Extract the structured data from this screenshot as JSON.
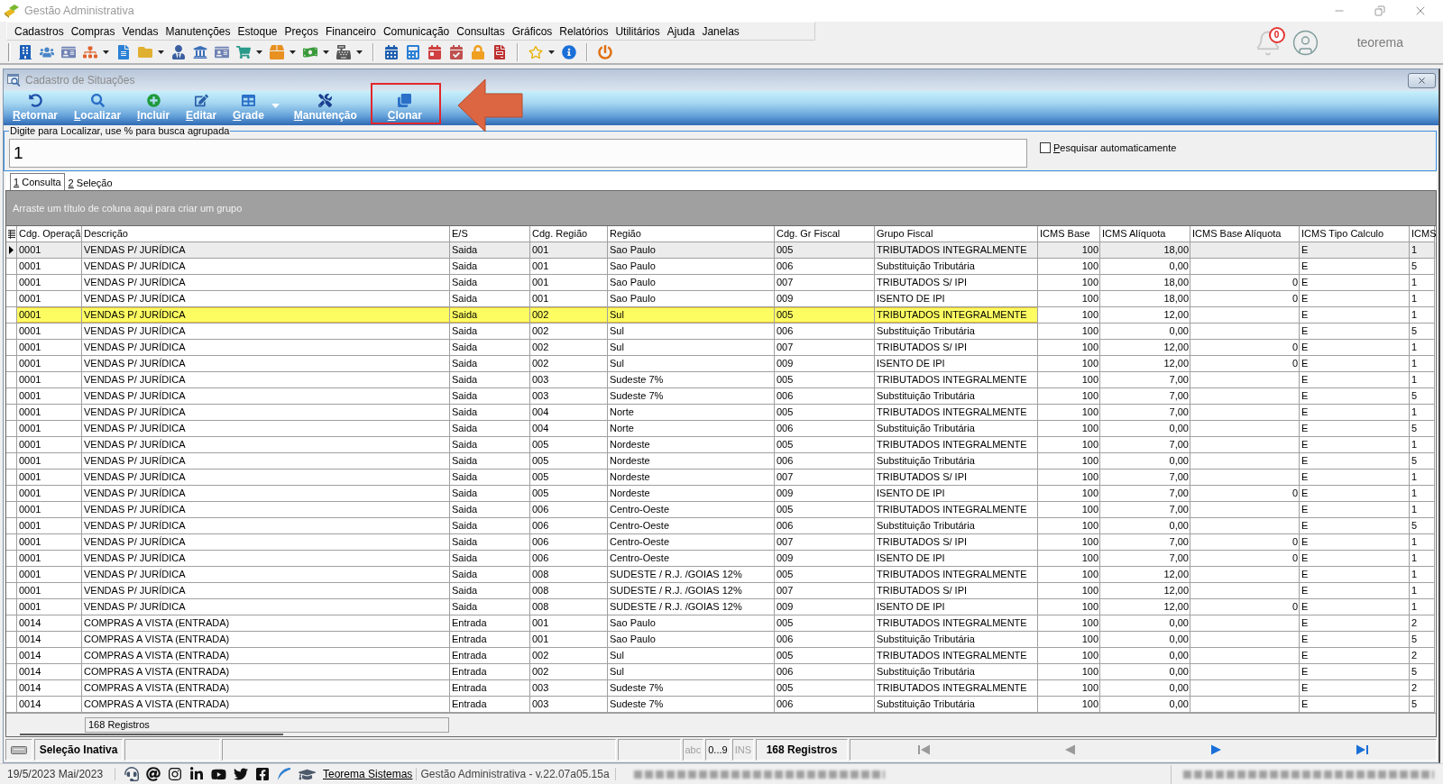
{
  "app_window": {
    "title": "Gestão Administrativa"
  },
  "menu": [
    "Cadastros",
    "Compras",
    "Vendas",
    "Manutenções",
    "Estoque",
    "Preços",
    "Financeiro",
    "Comunicação",
    "Consultas",
    "Gráficos",
    "Relatórios",
    "Utilitários",
    "Ajuda",
    "Janelas"
  ],
  "user_area": {
    "notification_count": "0",
    "user_name": "teorema"
  },
  "child_window": {
    "title": "Cadastro de Situações"
  },
  "toolbar": [
    {
      "label": "Retornar",
      "dropdown": false,
      "highlighted": false
    },
    {
      "label": "Localizar",
      "dropdown": false,
      "highlighted": false
    },
    {
      "label": "Incluir",
      "dropdown": false,
      "highlighted": false
    },
    {
      "label": "Editar",
      "dropdown": false,
      "highlighted": false
    },
    {
      "label": "Grade",
      "dropdown": true,
      "highlighted": false
    },
    {
      "label": "Manutenção",
      "dropdown": false,
      "highlighted": false
    },
    {
      "label": "Clonar",
      "dropdown": false,
      "highlighted": true
    }
  ],
  "search": {
    "legend": "Digite para Localizar, use % para busca agrupada",
    "value": "1",
    "auto_search": {
      "label": "Pesquisar automaticamente",
      "checked": false
    }
  },
  "tabs": [
    {
      "label": "1 Consulta",
      "selected": true
    },
    {
      "label": "2 Seleção",
      "selected": false
    }
  ],
  "group_panel": {
    "hint": "Arraste um título de coluna aqui para criar um grupo"
  },
  "table": {
    "columns": [
      "Cdg. Operaçã",
      "Descrição",
      "E/S",
      "Cdg. Região",
      "Região",
      "Cdg. Gr Fiscal",
      "Grupo Fiscal",
      "ICMS Base",
      "ICMS Alíquota",
      "ICMS Base Alíquota",
      "ICMS Tipo Calculo",
      "ICMS"
    ],
    "rows": [
      {
        "cdg_operacao": "0001",
        "descricao": "VENDAS P/ JURÍDICA",
        "e_s": "Saida",
        "cdg_regiao": "001",
        "regiao": "Sao Paulo",
        "cdg_gr_fiscal": "005",
        "grupo_fiscal": "TRIBUTADOS INTEGRALMENTE",
        "icms_base": "100",
        "icms_aliquota": "18,00",
        "icms_tipo_calculo": "E",
        "icms": "1",
        "selected": true,
        "highlighted": false
      },
      {
        "cdg_operacao": "0001",
        "descricao": "VENDAS P/ JURÍDICA",
        "e_s": "Saida",
        "cdg_regiao": "001",
        "regiao": "Sao Paulo",
        "cdg_gr_fiscal": "006",
        "grupo_fiscal": "Substituição Tributária",
        "icms_base": "100",
        "icms_aliquota": "0,00",
        "icms_tipo_calculo": "E",
        "icms": "5",
        "selected": false,
        "highlighted": false
      },
      {
        "cdg_operacao": "0001",
        "descricao": "VENDAS P/ JURÍDICA",
        "e_s": "Saida",
        "cdg_regiao": "001",
        "regiao": "Sao Paulo",
        "cdg_gr_fiscal": "007",
        "grupo_fiscal": "TRIBUTADOS S/ IPI",
        "icms_base": "100",
        "icms_aliquota": "18,00",
        "icms_base_aliquota": "0",
        "icms_tipo_calculo": "E",
        "icms": "1",
        "selected": false,
        "highlighted": false
      },
      {
        "cdg_operacao": "0001",
        "descricao": "VENDAS P/ JURÍDICA",
        "e_s": "Saida",
        "cdg_regiao": "001",
        "regiao": "Sao Paulo",
        "cdg_gr_fiscal": "009",
        "grupo_fiscal": "ISENTO DE IPI",
        "icms_base": "100",
        "icms_aliquota": "18,00",
        "icms_base_aliquota": "0",
        "icms_tipo_calculo": "E",
        "icms": "1",
        "selected": false,
        "highlighted": false
      },
      {
        "cdg_operacao": "0001",
        "descricao": "VENDAS P/ JURÍDICA",
        "e_s": "Saida",
        "cdg_regiao": "002",
        "regiao": "Sul",
        "cdg_gr_fiscal": "005",
        "grupo_fiscal": "TRIBUTADOS INTEGRALMENTE",
        "icms_base": "100",
        "icms_aliquota": "12,00",
        "icms_tipo_calculo": "E",
        "icms": "1",
        "selected": false,
        "highlighted": true
      },
      {
        "cdg_operacao": "0001",
        "descricao": "VENDAS P/ JURÍDICA",
        "e_s": "Saida",
        "cdg_regiao": "002",
        "regiao": "Sul",
        "cdg_gr_fiscal": "006",
        "grupo_fiscal": "Substituição Tributária",
        "icms_base": "100",
        "icms_aliquota": "0,00",
        "icms_tipo_calculo": "E",
        "icms": "5",
        "selected": false,
        "highlighted": false
      },
      {
        "cdg_operacao": "0001",
        "descricao": "VENDAS P/ JURÍDICA",
        "e_s": "Saida",
        "cdg_regiao": "002",
        "regiao": "Sul",
        "cdg_gr_fiscal": "007",
        "grupo_fiscal": "TRIBUTADOS S/ IPI",
        "icms_base": "100",
        "icms_aliquota": "12,00",
        "icms_base_aliquota": "0",
        "icms_tipo_calculo": "E",
        "icms": "1",
        "selected": false,
        "highlighted": false
      },
      {
        "cdg_operacao": "0001",
        "descricao": "VENDAS P/ JURÍDICA",
        "e_s": "Saida",
        "cdg_regiao": "002",
        "regiao": "Sul",
        "cdg_gr_fiscal": "009",
        "grupo_fiscal": "ISENTO DE IPI",
        "icms_base": "100",
        "icms_aliquota": "12,00",
        "icms_base_aliquota": "0",
        "icms_tipo_calculo": "E",
        "icms": "1",
        "selected": false,
        "highlighted": false
      },
      {
        "cdg_operacao": "0001",
        "descricao": "VENDAS P/ JURÍDICA",
        "e_s": "Saida",
        "cdg_regiao": "003",
        "regiao": "Sudeste 7%",
        "cdg_gr_fiscal": "005",
        "grupo_fiscal": "TRIBUTADOS INTEGRALMENTE",
        "icms_base": "100",
        "icms_aliquota": "7,00",
        "icms_tipo_calculo": "E",
        "icms": "1",
        "selected": false,
        "highlighted": false
      },
      {
        "cdg_operacao": "0001",
        "descricao": "VENDAS P/ JURÍDICA",
        "e_s": "Saida",
        "cdg_regiao": "003",
        "regiao": "Sudeste 7%",
        "cdg_gr_fiscal": "006",
        "grupo_fiscal": "Substituição Tributária",
        "icms_base": "100",
        "icms_aliquota": "7,00",
        "icms_tipo_calculo": "E",
        "icms": "5",
        "selected": false,
        "highlighted": false
      },
      {
        "cdg_operacao": "0001",
        "descricao": "VENDAS P/ JURÍDICA",
        "e_s": "Saida",
        "cdg_regiao": "004",
        "regiao": "Norte",
        "cdg_gr_fiscal": "005",
        "grupo_fiscal": "TRIBUTADOS INTEGRALMENTE",
        "icms_base": "100",
        "icms_aliquota": "7,00",
        "icms_tipo_calculo": "E",
        "icms": "1",
        "selected": false,
        "highlighted": false
      },
      {
        "cdg_operacao": "0001",
        "descricao": "VENDAS P/ JURÍDICA",
        "e_s": "Saida",
        "cdg_regiao": "004",
        "regiao": "Norte",
        "cdg_gr_fiscal": "006",
        "grupo_fiscal": "Substituição Tributária",
        "icms_base": "100",
        "icms_aliquota": "0,00",
        "icms_tipo_calculo": "E",
        "icms": "5",
        "selected": false,
        "highlighted": false
      },
      {
        "cdg_operacao": "0001",
        "descricao": "VENDAS P/ JURÍDICA",
        "e_s": "Saida",
        "cdg_regiao": "005",
        "regiao": "Nordeste",
        "cdg_gr_fiscal": "005",
        "grupo_fiscal": "TRIBUTADOS INTEGRALMENTE",
        "icms_base": "100",
        "icms_aliquota": "7,00",
        "icms_tipo_calculo": "E",
        "icms": "1",
        "selected": false,
        "highlighted": false
      },
      {
        "cdg_operacao": "0001",
        "descricao": "VENDAS P/ JURÍDICA",
        "e_s": "Saida",
        "cdg_regiao": "005",
        "regiao": "Nordeste",
        "cdg_gr_fiscal": "006",
        "grupo_fiscal": "Substituição Tributária",
        "icms_base": "100",
        "icms_aliquota": "0,00",
        "icms_tipo_calculo": "E",
        "icms": "5",
        "selected": false,
        "highlighted": false
      },
      {
        "cdg_operacao": "0001",
        "descricao": "VENDAS P/ JURÍDICA",
        "e_s": "Saida",
        "cdg_regiao": "005",
        "regiao": "Nordeste",
        "cdg_gr_fiscal": "007",
        "grupo_fiscal": "TRIBUTADOS S/ IPI",
        "icms_base": "100",
        "icms_aliquota": "7,00",
        "icms_tipo_calculo": "E",
        "icms": "1",
        "selected": false,
        "highlighted": false
      },
      {
        "cdg_operacao": "0001",
        "descricao": "VENDAS P/ JURÍDICA",
        "e_s": "Saida",
        "cdg_regiao": "005",
        "regiao": "Nordeste",
        "cdg_gr_fiscal": "009",
        "grupo_fiscal": "ISENTO DE IPI",
        "icms_base": "100",
        "icms_aliquota": "7,00",
        "icms_base_aliquota": "0",
        "icms_tipo_calculo": "E",
        "icms": "1",
        "selected": false,
        "highlighted": false
      },
      {
        "cdg_operacao": "0001",
        "descricao": "VENDAS P/ JURÍDICA",
        "e_s": "Saida",
        "cdg_regiao": "006",
        "regiao": "Centro-Oeste",
        "cdg_gr_fiscal": "005",
        "grupo_fiscal": "TRIBUTADOS INTEGRALMENTE",
        "icms_base": "100",
        "icms_aliquota": "7,00",
        "icms_tipo_calculo": "E",
        "icms": "1",
        "selected": false,
        "highlighted": false
      },
      {
        "cdg_operacao": "0001",
        "descricao": "VENDAS P/ JURÍDICA",
        "e_s": "Saida",
        "cdg_regiao": "006",
        "regiao": "Centro-Oeste",
        "cdg_gr_fiscal": "006",
        "grupo_fiscal": "Substituição Tributária",
        "icms_base": "100",
        "icms_aliquota": "0,00",
        "icms_tipo_calculo": "E",
        "icms": "5",
        "selected": false,
        "highlighted": false
      },
      {
        "cdg_operacao": "0001",
        "descricao": "VENDAS P/ JURÍDICA",
        "e_s": "Saida",
        "cdg_regiao": "006",
        "regiao": "Centro-Oeste",
        "cdg_gr_fiscal": "007",
        "grupo_fiscal": "TRIBUTADOS S/ IPI",
        "icms_base": "100",
        "icms_aliquota": "7,00",
        "icms_base_aliquota": "0",
        "icms_tipo_calculo": "E",
        "icms": "1",
        "selected": false,
        "highlighted": false
      },
      {
        "cdg_operacao": "0001",
        "descricao": "VENDAS P/ JURÍDICA",
        "e_s": "Saida",
        "cdg_regiao": "006",
        "regiao": "Centro-Oeste",
        "cdg_gr_fiscal": "009",
        "grupo_fiscal": "ISENTO DE IPI",
        "icms_base": "100",
        "icms_aliquota": "7,00",
        "icms_base_aliquota": "0",
        "icms_tipo_calculo": "E",
        "icms": "1",
        "selected": false,
        "highlighted": false
      },
      {
        "cdg_operacao": "0001",
        "descricao": "VENDAS P/ JURÍDICA",
        "e_s": "Saida",
        "cdg_regiao": "008",
        "regiao": "SUDESTE / R.J. /GOIAS 12%",
        "cdg_gr_fiscal": "005",
        "grupo_fiscal": "TRIBUTADOS INTEGRALMENTE",
        "icms_base": "100",
        "icms_aliquota": "12,00",
        "icms_tipo_calculo": "E",
        "icms": "1",
        "selected": false,
        "highlighted": false
      },
      {
        "cdg_operacao": "0001",
        "descricao": "VENDAS P/ JURÍDICA",
        "e_s": "Saida",
        "cdg_regiao": "008",
        "regiao": "SUDESTE / R.J. /GOIAS 12%",
        "cdg_gr_fiscal": "007",
        "grupo_fiscal": "TRIBUTADOS S/ IPI",
        "icms_base": "100",
        "icms_aliquota": "12,00",
        "icms_tipo_calculo": "E",
        "icms": "1",
        "selected": false,
        "highlighted": false
      },
      {
        "cdg_operacao": "0001",
        "descricao": "VENDAS P/ JURÍDICA",
        "e_s": "Saida",
        "cdg_regiao": "008",
        "regiao": "SUDESTE / R.J. /GOIAS 12%",
        "cdg_gr_fiscal": "009",
        "grupo_fiscal": "ISENTO DE IPI",
        "icms_base": "100",
        "icms_aliquota": "12,00",
        "icms_base_aliquota": "0",
        "icms_tipo_calculo": "E",
        "icms": "1",
        "selected": false,
        "highlighted": false
      },
      {
        "cdg_operacao": "0014",
        "descricao": "COMPRAS A VISTA (ENTRADA)",
        "e_s": "Entrada",
        "cdg_regiao": "001",
        "regiao": "Sao Paulo",
        "cdg_gr_fiscal": "005",
        "grupo_fiscal": "TRIBUTADOS INTEGRALMENTE",
        "icms_base": "100",
        "icms_aliquota": "0,00",
        "icms_tipo_calculo": "E",
        "icms": "2",
        "selected": false,
        "highlighted": false
      },
      {
        "cdg_operacao": "0014",
        "descricao": "COMPRAS A VISTA (ENTRADA)",
        "e_s": "Entrada",
        "cdg_regiao": "001",
        "regiao": "Sao Paulo",
        "cdg_gr_fiscal": "006",
        "grupo_fiscal": "Substituição Tributária",
        "icms_base": "100",
        "icms_aliquota": "0,00",
        "icms_tipo_calculo": "E",
        "icms": "5",
        "selected": false,
        "highlighted": false
      },
      {
        "cdg_operacao": "0014",
        "descricao": "COMPRAS A VISTA (ENTRADA)",
        "e_s": "Entrada",
        "cdg_regiao": "002",
        "regiao": "Sul",
        "cdg_gr_fiscal": "005",
        "grupo_fiscal": "TRIBUTADOS INTEGRALMENTE",
        "icms_base": "100",
        "icms_aliquota": "0,00",
        "icms_tipo_calculo": "E",
        "icms": "2",
        "selected": false,
        "highlighted": false
      },
      {
        "cdg_operacao": "0014",
        "descricao": "COMPRAS A VISTA (ENTRADA)",
        "e_s": "Entrada",
        "cdg_regiao": "002",
        "regiao": "Sul",
        "cdg_gr_fiscal": "006",
        "grupo_fiscal": "Substituição Tributária",
        "icms_base": "100",
        "icms_aliquota": "0,00",
        "icms_tipo_calculo": "E",
        "icms": "5",
        "selected": false,
        "highlighted": false
      },
      {
        "cdg_operacao": "0014",
        "descricao": "COMPRAS A VISTA (ENTRADA)",
        "e_s": "Entrada",
        "cdg_regiao": "003",
        "regiao": "Sudeste 7%",
        "cdg_gr_fiscal": "005",
        "grupo_fiscal": "TRIBUTADOS INTEGRALMENTE",
        "icms_base": "100",
        "icms_aliquota": "0,00",
        "icms_tipo_calculo": "E",
        "icms": "2",
        "selected": false,
        "highlighted": false
      },
      {
        "cdg_operacao": "0014",
        "descricao": "COMPRAS A VISTA (ENTRADA)",
        "e_s": "Entrada",
        "cdg_regiao": "003",
        "regiao": "Sudeste 7%",
        "cdg_gr_fiscal": "006",
        "grupo_fiscal": "Substituição Tributária",
        "icms_base": "100",
        "icms_aliquota": "0,00",
        "icms_tipo_calculo": "E",
        "icms": "5",
        "selected": false,
        "highlighted": false
      }
    ]
  },
  "footer": {
    "summary": "168 Registros"
  },
  "status_bar": {
    "selection": "Seleção Inativa",
    "indicators": [
      {
        "label": "abc",
        "active": false
      },
      {
        "label": "0...9",
        "active": true
      },
      {
        "label": "INS",
        "active": false
      }
    ],
    "record_count": "168 Registros",
    "navigation": [
      {
        "kind": "first",
        "disabled": true
      },
      {
        "kind": "prior",
        "disabled": true
      },
      {
        "kind": "next",
        "disabled": false
      },
      {
        "kind": "last",
        "disabled": false
      }
    ]
  },
  "bottom_bar": {
    "date": "19/5/2023 Mai/2023",
    "link": "Teorema Sistemas",
    "version": "Gestão Administrativa - v.22.07a05.15a"
  }
}
